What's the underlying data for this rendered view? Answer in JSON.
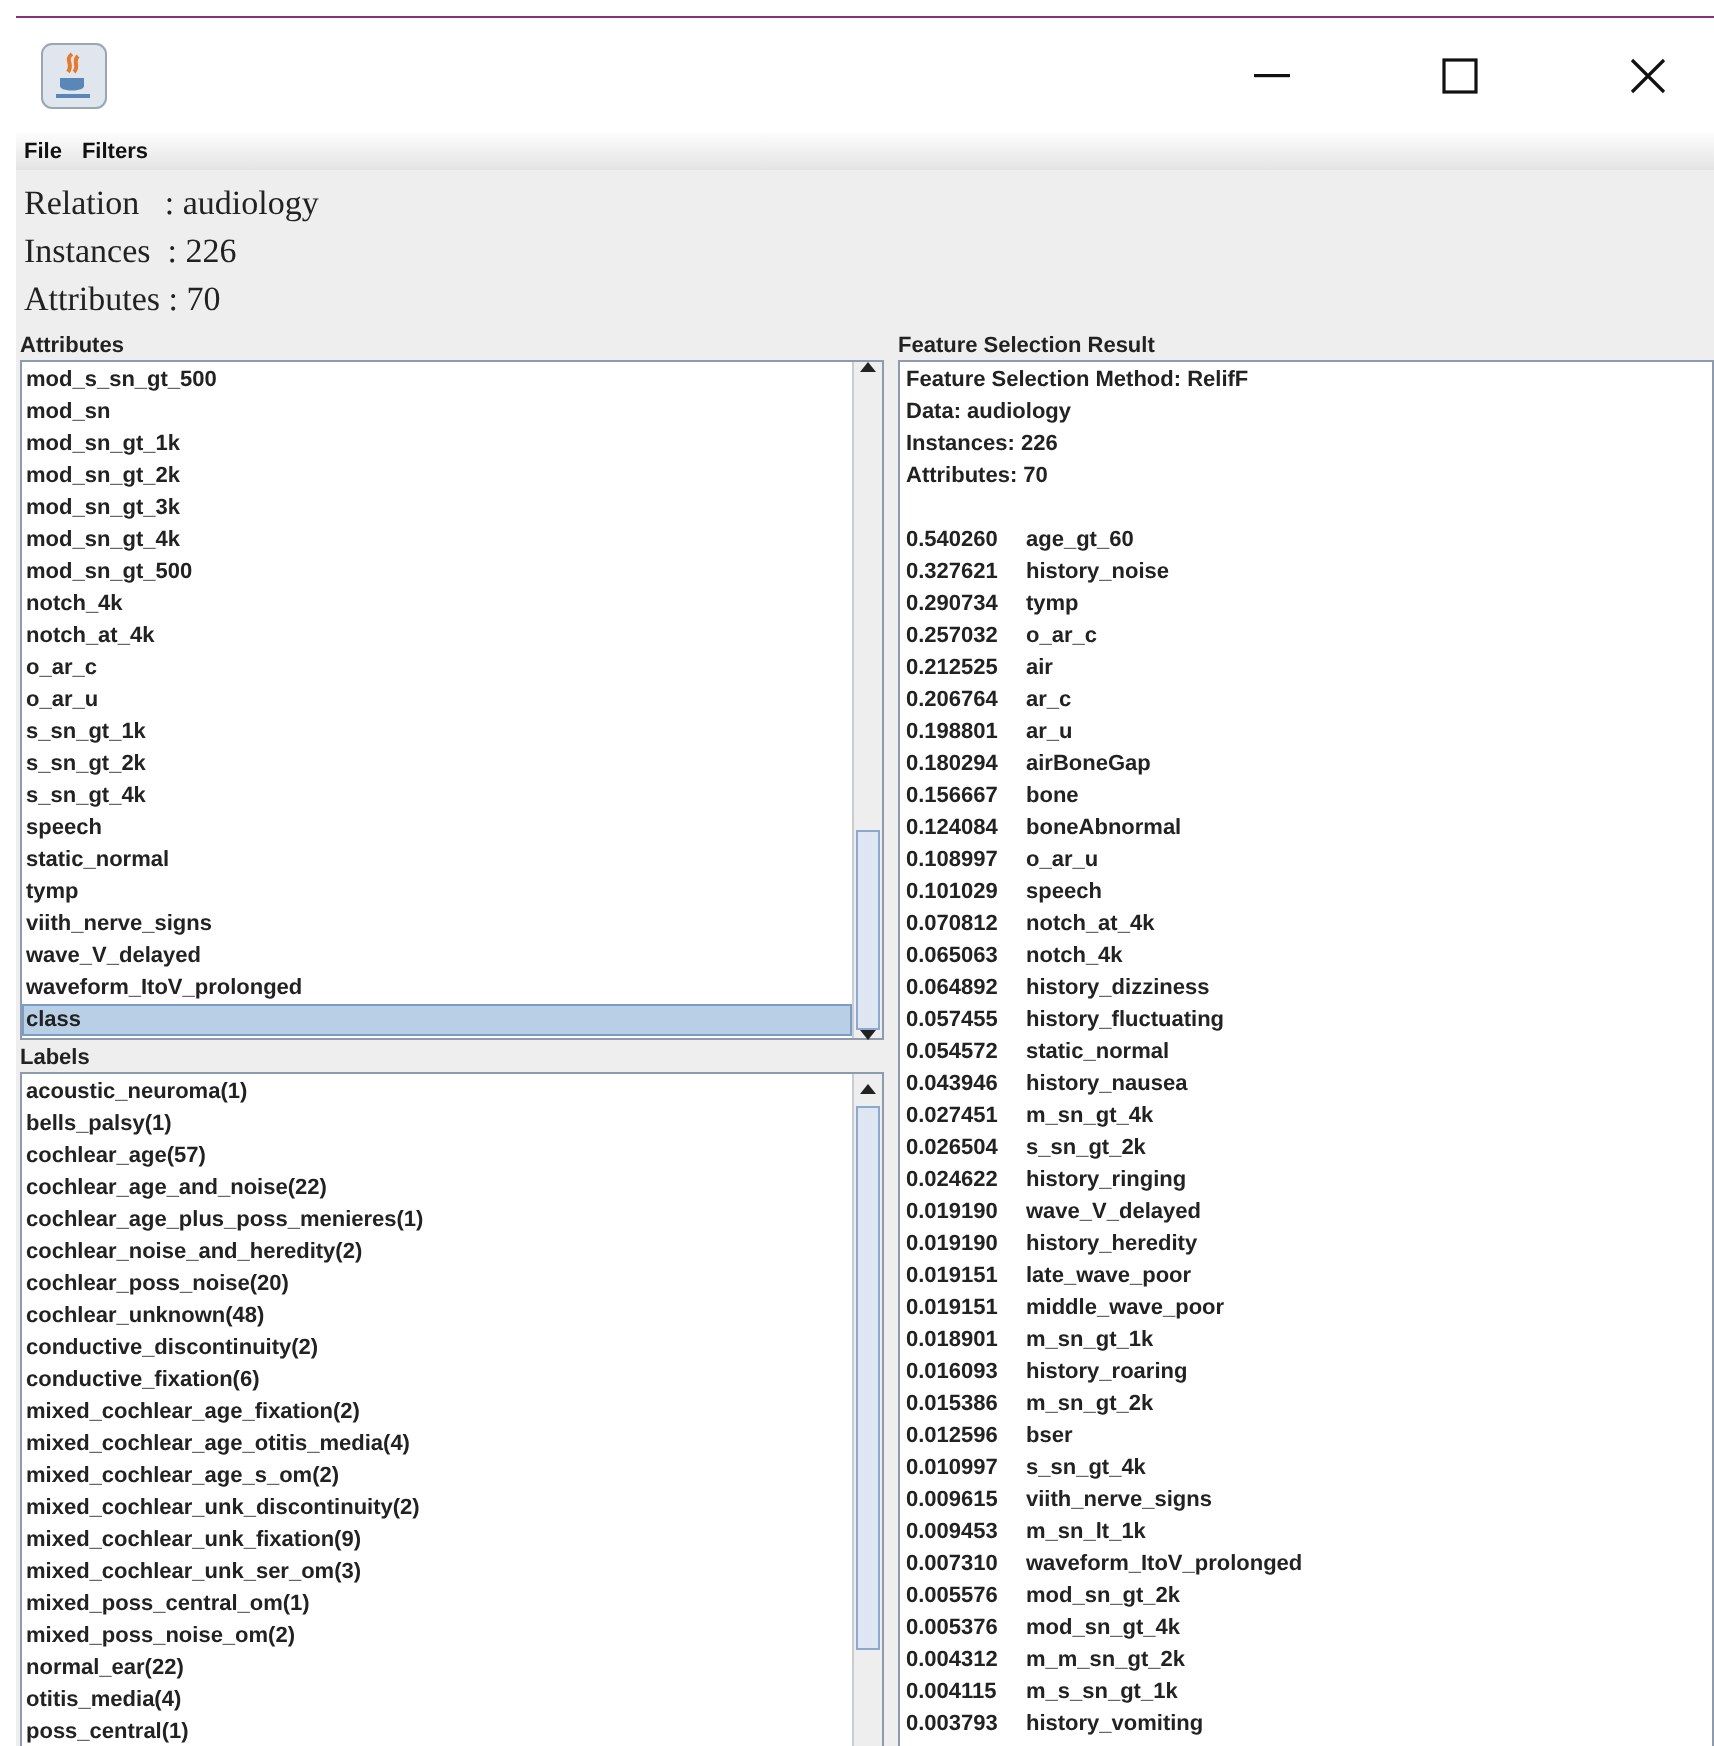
{
  "menu": [
    "File",
    "Filters"
  ],
  "summary": [
    "Relation   : audiology",
    "Instances  : 226",
    "Attributes : 70"
  ],
  "attributes": {
    "title": "Attributes",
    "items": [
      {
        "name": "mod_s_sn_gt_500",
        "selected": false
      },
      {
        "name": "mod_sn",
        "selected": false
      },
      {
        "name": "mod_sn_gt_1k",
        "selected": false
      },
      {
        "name": "mod_sn_gt_2k",
        "selected": false
      },
      {
        "name": "mod_sn_gt_3k",
        "selected": false
      },
      {
        "name": "mod_sn_gt_4k",
        "selected": false
      },
      {
        "name": "mod_sn_gt_500",
        "selected": false
      },
      {
        "name": "notch_4k",
        "selected": false
      },
      {
        "name": "notch_at_4k",
        "selected": false
      },
      {
        "name": "o_ar_c",
        "selected": false
      },
      {
        "name": "o_ar_u",
        "selected": false
      },
      {
        "name": "s_sn_gt_1k",
        "selected": false
      },
      {
        "name": "s_sn_gt_2k",
        "selected": false
      },
      {
        "name": "s_sn_gt_4k",
        "selected": false
      },
      {
        "name": "speech",
        "selected": false
      },
      {
        "name": "static_normal",
        "selected": false
      },
      {
        "name": "tymp",
        "selected": false
      },
      {
        "name": "viith_nerve_signs",
        "selected": false
      },
      {
        "name": "wave_V_delayed",
        "selected": false
      },
      {
        "name": "waveform_ItoV_prolonged",
        "selected": false
      },
      {
        "name": "class",
        "selected": true
      }
    ]
  },
  "labels": {
    "title": "Labels",
    "items": [
      {
        "name": "acoustic_neuroma(1)",
        "selected": false
      },
      {
        "name": "bells_palsy(1)",
        "selected": false
      },
      {
        "name": "cochlear_age(57)",
        "selected": false
      },
      {
        "name": "cochlear_age_and_noise(22)",
        "selected": false
      },
      {
        "name": "cochlear_age_plus_poss_menieres(1)",
        "selected": false
      },
      {
        "name": "cochlear_noise_and_heredity(2)",
        "selected": false
      },
      {
        "name": "cochlear_poss_noise(20)",
        "selected": false
      },
      {
        "name": "cochlear_unknown(48)",
        "selected": false
      },
      {
        "name": "conductive_discontinuity(2)",
        "selected": false
      },
      {
        "name": "conductive_fixation(6)",
        "selected": false
      },
      {
        "name": "mixed_cochlear_age_fixation(2)",
        "selected": false
      },
      {
        "name": "mixed_cochlear_age_otitis_media(4)",
        "selected": false
      },
      {
        "name": "mixed_cochlear_age_s_om(2)",
        "selected": false
      },
      {
        "name": "mixed_cochlear_unk_discontinuity(2)",
        "selected": false
      },
      {
        "name": "mixed_cochlear_unk_fixation(9)",
        "selected": false
      },
      {
        "name": "mixed_cochlear_unk_ser_om(3)",
        "selected": false
      },
      {
        "name": "mixed_poss_central_om(1)",
        "selected": false
      },
      {
        "name": "mixed_poss_noise_om(2)",
        "selected": false
      },
      {
        "name": "normal_ear(22)",
        "selected": false
      },
      {
        "name": "otitis_media(4)",
        "selected": false
      },
      {
        "name": "poss_central(1)",
        "selected": false
      }
    ]
  },
  "result": {
    "title": "Feature Selection Result",
    "header": [
      "Feature Selection Method: RelifF",
      "Data: audiology",
      "Instances: 226",
      "Attributes: 70"
    ],
    "rankings": [
      {
        "score": "0.540260",
        "attribute": "age_gt_60"
      },
      {
        "score": "0.327621",
        "attribute": "history_noise"
      },
      {
        "score": "0.290734",
        "attribute": "tymp"
      },
      {
        "score": "0.257032",
        "attribute": "o_ar_c"
      },
      {
        "score": "0.212525",
        "attribute": "air"
      },
      {
        "score": "0.206764",
        "attribute": "ar_c"
      },
      {
        "score": "0.198801",
        "attribute": "ar_u"
      },
      {
        "score": "0.180294",
        "attribute": "airBoneGap"
      },
      {
        "score": "0.156667",
        "attribute": "bone"
      },
      {
        "score": "0.124084",
        "attribute": "boneAbnormal"
      },
      {
        "score": "0.108997",
        "attribute": "o_ar_u"
      },
      {
        "score": "0.101029",
        "attribute": "speech"
      },
      {
        "score": "0.070812",
        "attribute": "notch_at_4k"
      },
      {
        "score": "0.065063",
        "attribute": "notch_4k"
      },
      {
        "score": "0.064892",
        "attribute": "history_dizziness"
      },
      {
        "score": "0.057455",
        "attribute": "history_fluctuating"
      },
      {
        "score": "0.054572",
        "attribute": "static_normal"
      },
      {
        "score": "0.043946",
        "attribute": "history_nausea"
      },
      {
        "score": "0.027451",
        "attribute": "m_sn_gt_4k"
      },
      {
        "score": "0.026504",
        "attribute": "s_sn_gt_2k"
      },
      {
        "score": "0.024622",
        "attribute": "history_ringing"
      },
      {
        "score": "0.019190",
        "attribute": "wave_V_delayed"
      },
      {
        "score": "0.019190",
        "attribute": "history_heredity"
      },
      {
        "score": "0.019151",
        "attribute": "late_wave_poor"
      },
      {
        "score": "0.019151",
        "attribute": "middle_wave_poor"
      },
      {
        "score": "0.018901",
        "attribute": "m_sn_gt_1k"
      },
      {
        "score": "0.016093",
        "attribute": "history_roaring"
      },
      {
        "score": "0.015386",
        "attribute": "m_sn_gt_2k"
      },
      {
        "score": "0.012596",
        "attribute": "bser"
      },
      {
        "score": "0.010997",
        "attribute": "s_sn_gt_4k"
      },
      {
        "score": "0.009615",
        "attribute": "viith_nerve_signs"
      },
      {
        "score": "0.009453",
        "attribute": "m_sn_lt_1k"
      },
      {
        "score": "0.007310",
        "attribute": "waveform_ItoV_prolonged"
      },
      {
        "score": "0.005576",
        "attribute": "mod_sn_gt_2k"
      },
      {
        "score": "0.005376",
        "attribute": "mod_sn_gt_4k"
      },
      {
        "score": "0.004312",
        "attribute": "m_m_sn_gt_2k"
      },
      {
        "score": "0.004115",
        "attribute": "m_s_sn_gt_1k"
      },
      {
        "score": "0.003793",
        "attribute": "history_vomiting"
      }
    ]
  }
}
